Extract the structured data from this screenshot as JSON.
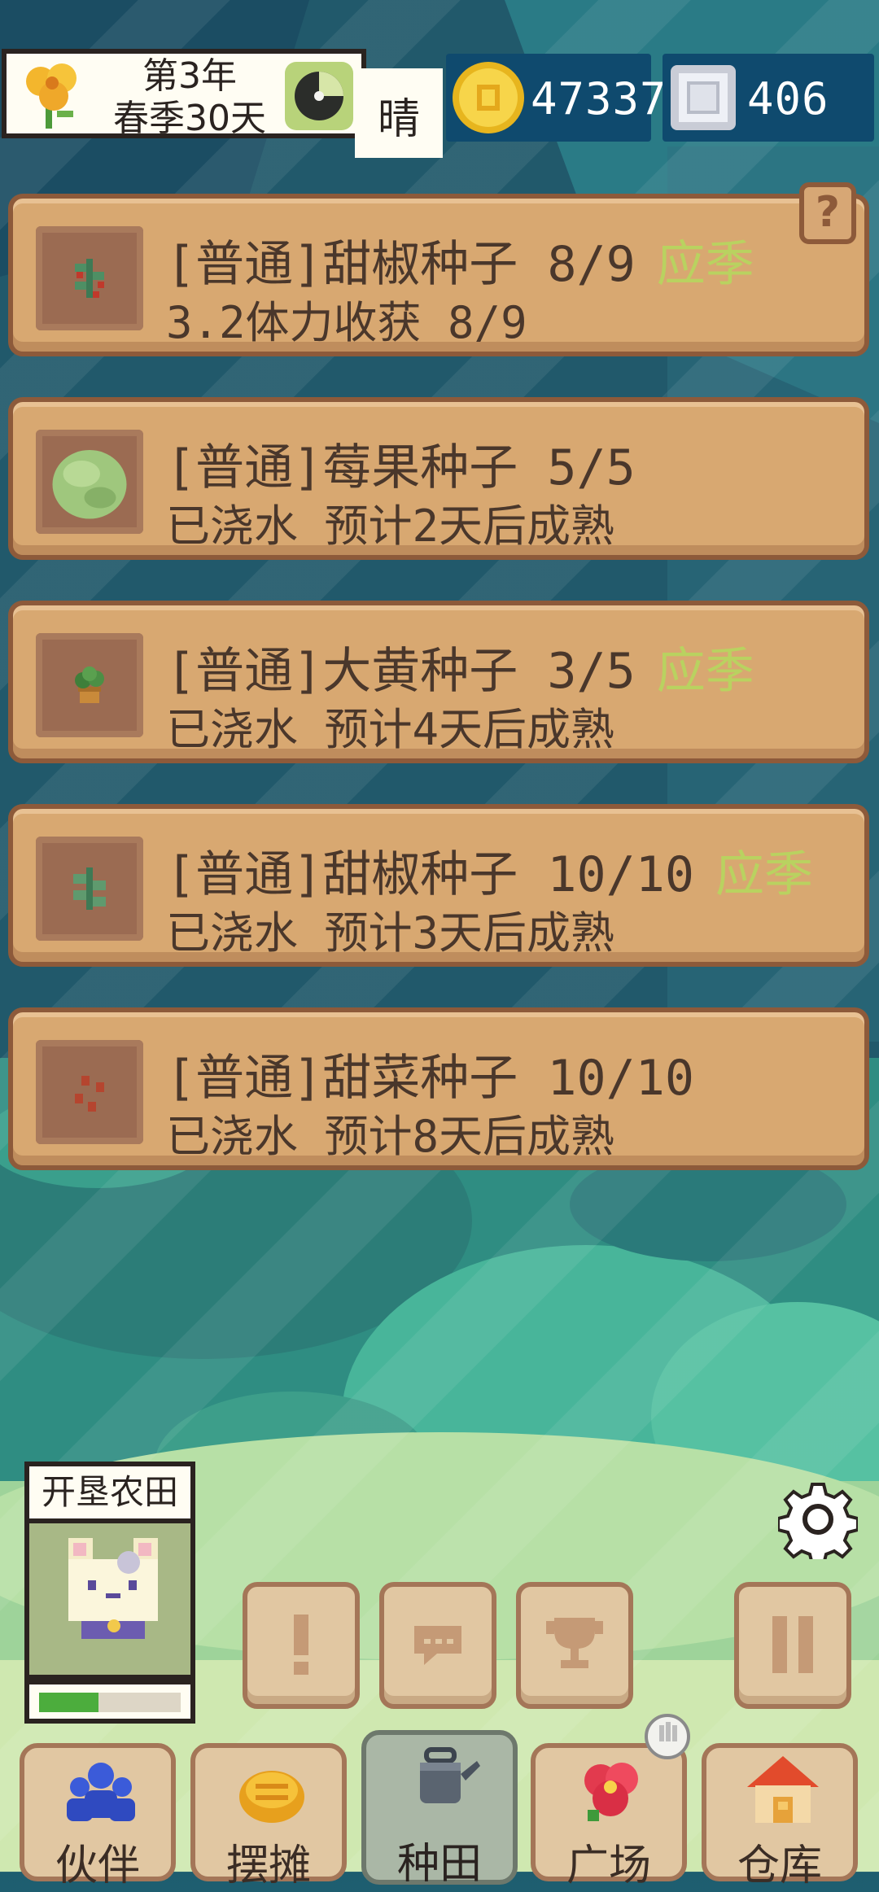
{
  "hud": {
    "date_line1": "第3年",
    "date_line2": "春季30天",
    "weather": "晴",
    "gold": "47337",
    "gems": "406"
  },
  "help_label": "?",
  "crops": [
    {
      "title": "[普通]甜椒种子 8/9",
      "season": "应季",
      "status": "3.2体力收获 8/9",
      "icon": "pepper-sprout-icon"
    },
    {
      "title": "[普通]莓果种子 5/5",
      "season": "",
      "status": "已浇水 预计2天后成熟",
      "icon": "berry-bush-icon"
    },
    {
      "title": "[普通]大黄种子 3/5",
      "season": "应季",
      "status": "已浇水 预计4天后成熟",
      "icon": "rhubarb-pot-icon"
    },
    {
      "title": "[普通]甜椒种子 10/10",
      "season": "应季",
      "status": "已浇水 预计3天后成熟",
      "icon": "pepper-leaf-icon"
    },
    {
      "title": "[普通]甜菜种子 10/10",
      "season": "",
      "status": "已浇水 预计8天后成熟",
      "icon": "beet-seed-icon"
    }
  ],
  "character": {
    "label": "开垦农田",
    "energy_fraction": 0.42
  },
  "action_buttons": [
    {
      "icon": "exclamation-icon"
    },
    {
      "icon": "chat-bubble-icon"
    },
    {
      "icon": "trophy-icon"
    },
    {
      "icon": "pause-icon"
    }
  ],
  "nav": [
    {
      "label": "伙伴",
      "icon": "partners-icon"
    },
    {
      "label": "摆摊",
      "icon": "stall-icon"
    },
    {
      "label": "种田",
      "icon": "watering-can-icon",
      "active": true
    },
    {
      "label": "广场",
      "icon": "plaza-flower-icon"
    },
    {
      "label": "仓库",
      "icon": "warehouse-icon"
    }
  ],
  "colors": {
    "card_bg": "#d8a871",
    "card_border": "#8d5a3a",
    "season_text": "#b9d260",
    "currency_bg": "#0f4a6e",
    "energy_fill": "#4cad3d"
  }
}
